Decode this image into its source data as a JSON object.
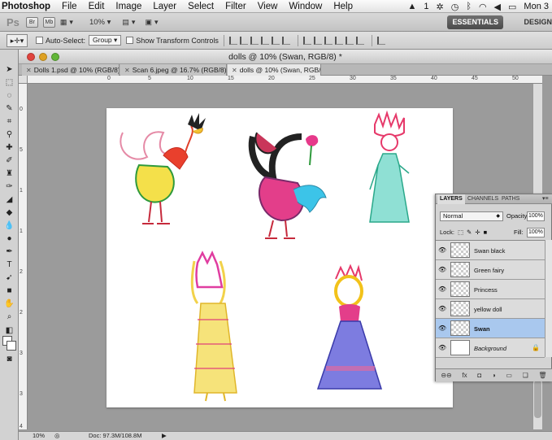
{
  "menubar": {
    "app": "Photoshop",
    "menus": [
      "File",
      "Edit",
      "Image",
      "Layer",
      "Select",
      "Filter",
      "View",
      "Window",
      "Help"
    ],
    "status_number": "1",
    "clock": "Mon 3"
  },
  "appbar": {
    "logo": "Ps",
    "bridge": "Br",
    "minibridge": "Mb",
    "zoom": "10%",
    "essentials": "ESSENTIALS",
    "design": "DESIGN"
  },
  "options": {
    "auto_select_label": "Auto-Select:",
    "auto_select_value": "Group",
    "transform_label": "Show Transform Controls"
  },
  "document": {
    "title": "dolls @ 10% (Swan, RGB/8) *",
    "tabs": [
      {
        "label": "Dolls 1.psd @ 10% (RGB/8) *"
      },
      {
        "label": "Scan 6.jpeg @ 16.7% (RGB/8) *"
      },
      {
        "label": "dolls @ 10% (Swan, RGB/8) *"
      }
    ],
    "ruler_h": [
      "0",
      "5",
      "10",
      "15",
      "20",
      "25",
      "30",
      "35",
      "40",
      "45",
      "50"
    ],
    "ruler_v": [
      "0",
      "5",
      "1",
      "1",
      "2",
      "2",
      "3",
      "3",
      "4"
    ],
    "status_zoom": "10%",
    "status_doc": "Doc: 97.3M/108.8M"
  },
  "layers_panel": {
    "tabs": [
      "LAYERS",
      "CHANNELS",
      "PATHS"
    ],
    "blend_mode": "Normal",
    "opacity_label": "Opacity:",
    "opacity_value": "100%",
    "lock_label": "Lock:",
    "fill_label": "Fill:",
    "fill_value": "100%",
    "layers": [
      {
        "name": "Swan black"
      },
      {
        "name": "Green fairy"
      },
      {
        "name": "Princess"
      },
      {
        "name": "yellow doll"
      },
      {
        "name": "Swan"
      },
      {
        "name": "Background"
      }
    ],
    "selected_layer": "Swan"
  }
}
